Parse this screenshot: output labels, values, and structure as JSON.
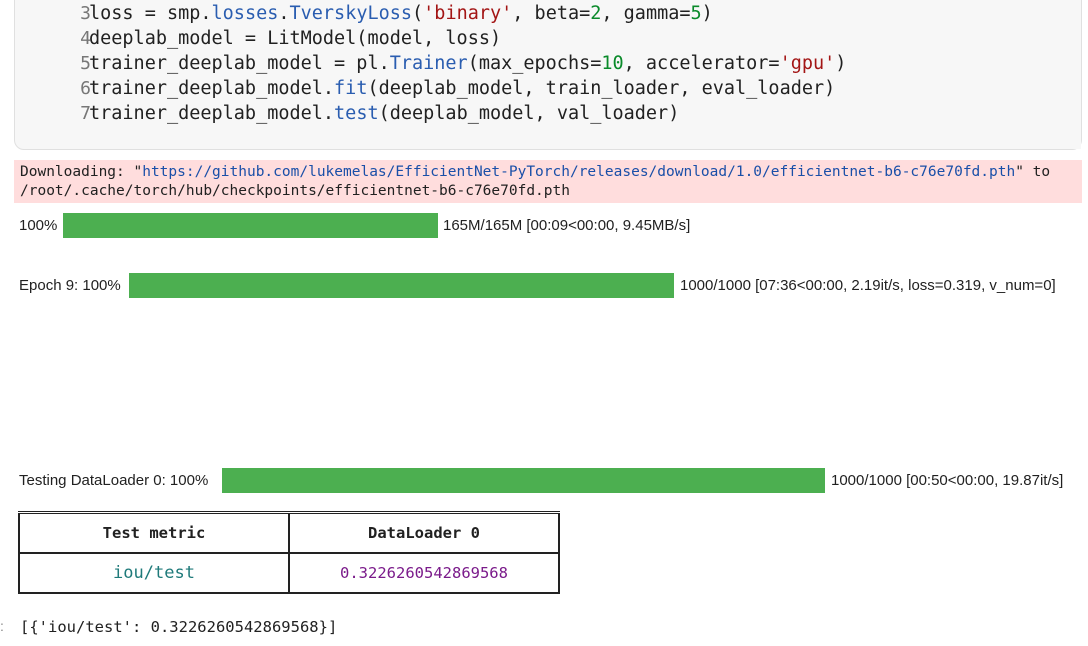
{
  "code_cell": {
    "lines": [
      {
        "num": "3",
        "parts": [
          {
            "t": "loss = smp.",
            "c": ""
          },
          {
            "t": "losses",
            "c": "kw-attr"
          },
          {
            "t": ".",
            "c": ""
          },
          {
            "t": "TverskyLoss",
            "c": "kw-attr"
          },
          {
            "t": "(",
            "c": ""
          },
          {
            "t": "'binary'",
            "c": "str"
          },
          {
            "t": ", beta=",
            "c": ""
          },
          {
            "t": "2",
            "c": "num"
          },
          {
            "t": ", gamma=",
            "c": ""
          },
          {
            "t": "5",
            "c": "num"
          },
          {
            "t": ")",
            "c": ""
          }
        ]
      },
      {
        "num": "4",
        "parts": [
          {
            "t": "deeplab_model = LitModel(model, loss)",
            "c": ""
          }
        ]
      },
      {
        "num": "5",
        "parts": [
          {
            "t": "trainer_deeplab_model = pl.",
            "c": ""
          },
          {
            "t": "Trainer",
            "c": "kw-attr"
          },
          {
            "t": "(max_epochs=",
            "c": ""
          },
          {
            "t": "10",
            "c": "num"
          },
          {
            "t": ", accelerator=",
            "c": ""
          },
          {
            "t": "'gpu'",
            "c": "str"
          },
          {
            "t": ")",
            "c": ""
          }
        ]
      },
      {
        "num": "6",
        "parts": [
          {
            "t": "trainer_deeplab_model.",
            "c": ""
          },
          {
            "t": "fit",
            "c": "kw-attr"
          },
          {
            "t": "(deeplab_model, train_loader, eval_loader)",
            "c": ""
          }
        ]
      },
      {
        "num": "7",
        "parts": [
          {
            "t": "trainer_deeplab_model.",
            "c": ""
          },
          {
            "t": "test",
            "c": "kw-attr"
          },
          {
            "t": "(deeplab_model, val_loader)",
            "c": ""
          }
        ]
      }
    ]
  },
  "stderr": {
    "prefix": "Downloading: \"",
    "url": "https://github.com/lukemelas/EfficientNet-PyTorch/releases/download/1.0/efficientnet-b6-c76e70fd.pth",
    "suffix": "\" to",
    "line2": "/root/.cache/torch/hub/checkpoints/efficientnet-b6-c76e70fd.pth"
  },
  "progress": {
    "download": {
      "label": "100%",
      "info": "165M/165M [00:09<00:00, 9.45MB/s]",
      "fraction": 1.0
    },
    "epoch": {
      "label": "Epoch 9: 100%",
      "info": "1000/1000 [07:36<00:00, 2.19it/s, loss=0.319, v_num=0]",
      "fraction": 1.0
    },
    "testing": {
      "label": "Testing DataLoader 0: 100%",
      "info": "1000/1000 [00:50<00:00, 19.87it/s]",
      "fraction": 1.0
    }
  },
  "results_table": {
    "headers": [
      "Test metric",
      "DataLoader 0"
    ],
    "rows": [
      [
        "iou/test",
        "0.3226260542869568"
      ]
    ]
  },
  "result_output": "[{'iou/test': 0.3226260542869568}]",
  "output_prompt": ":",
  "colors": {
    "progress_fill": "#4caf50",
    "stderr_bg": "#ffdddd"
  }
}
